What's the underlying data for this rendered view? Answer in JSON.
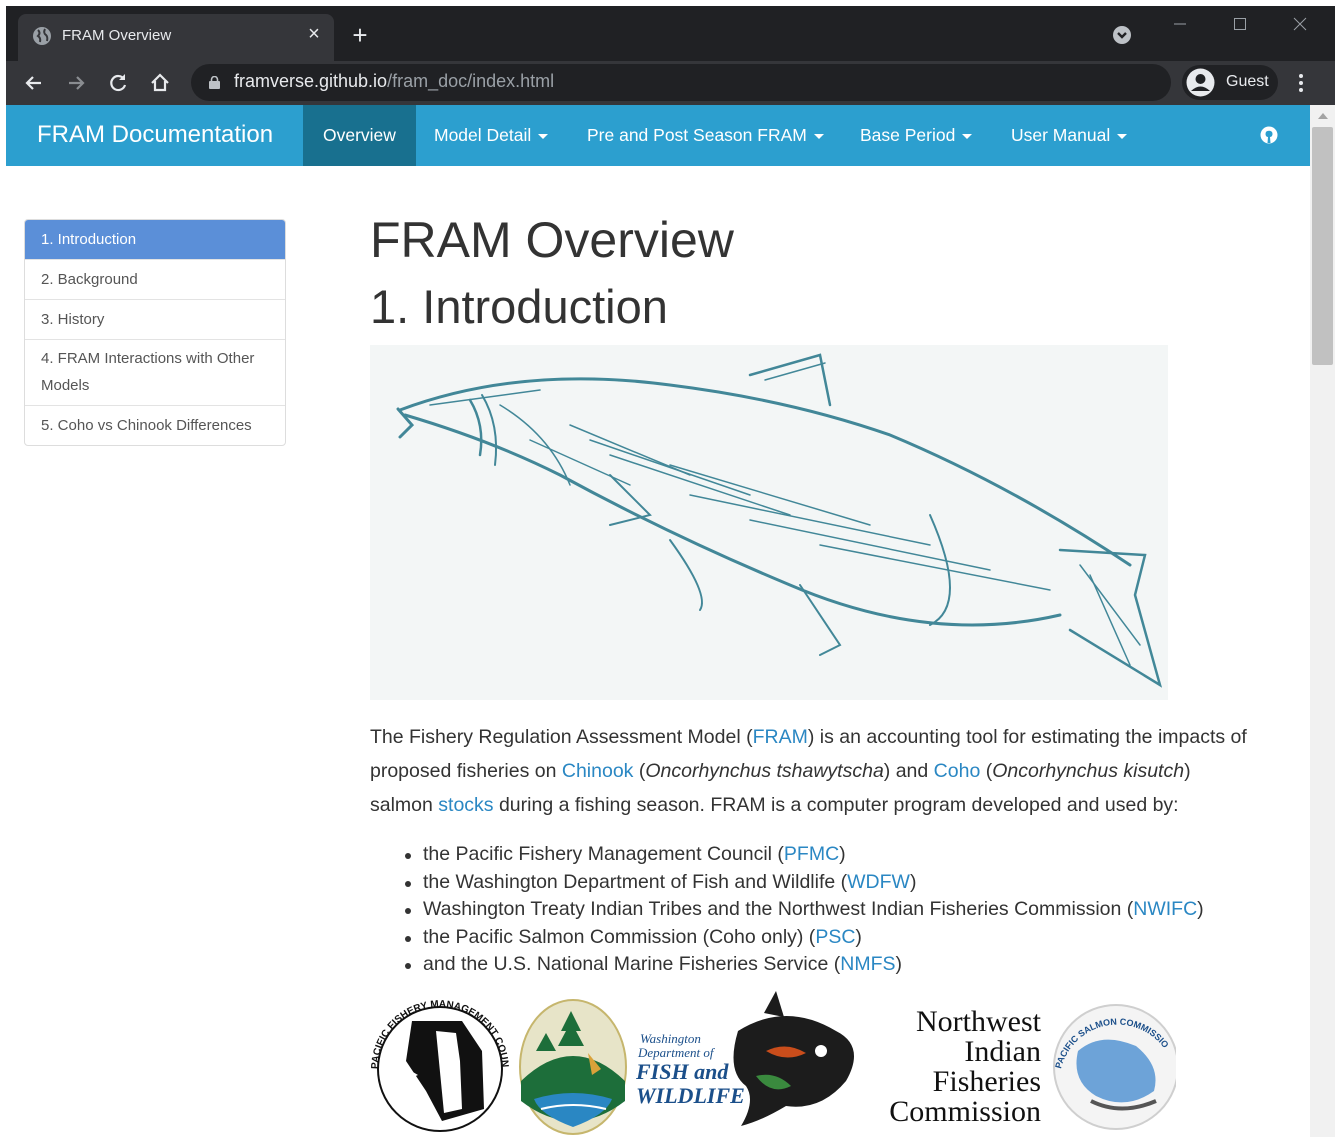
{
  "browser": {
    "tab_title": "FRAM Overview",
    "tab_close": "×",
    "new_tab": "+",
    "url_host": "framverse.github.io",
    "url_path": "/fram_doc/index.html",
    "profile_name": "Guest"
  },
  "navbar": {
    "brand": "FRAM Documentation",
    "items": [
      {
        "label": "Overview",
        "active": true,
        "dropdown": false
      },
      {
        "label": "Model Detail",
        "dropdown": true
      },
      {
        "label": "Pre and Post Season FRAM",
        "dropdown": true
      },
      {
        "label": "Base Period",
        "dropdown": true
      },
      {
        "label": "User Manual",
        "dropdown": true
      }
    ],
    "accent": "#2c9fcf",
    "active_bg": "#18708f"
  },
  "sidebar": {
    "items": [
      {
        "label": "1. Introduction",
        "active": true
      },
      {
        "label": "2. Background"
      },
      {
        "label": "3. History"
      },
      {
        "label": "4. FRAM Interactions with Other"
      },
      {
        "label": "Models"
      },
      {
        "label": "5. Coho vs Chinook Differences"
      }
    ]
  },
  "main": {
    "title": "FRAM Overview",
    "section": "1. Introduction",
    "para": {
      "t1": "The Fishery Regulation Assessment Model (",
      "fram": "FRAM",
      "t2": ") is an accounting tool for estimating the impacts of proposed fisheries on ",
      "chinook": "Chinook",
      "t3": " (",
      "chinook_sci": "Oncorhynchus tshawytscha",
      "t4": ") and ",
      "coho": "Coho",
      "t5": " (",
      "coho_sci": "Oncorhynchus kisutch",
      "t6": ") salmon ",
      "stocks": "stocks",
      "t7": " during a fishing season. FRAM is a computer program developed and used by:"
    },
    "bullets": [
      {
        "text": "the Pacific Fishery Management Council (",
        "link": "PFMC",
        "end": ")"
      },
      {
        "text": "the Washington Department of Fish and Wildlife (",
        "link": "WDFW",
        "end": ")"
      },
      {
        "text": "Washington Treaty Indian Tribes and the Northwest Indian Fisheries Commission (",
        "link": "NWIFC",
        "end": ")"
      },
      {
        "text": "the Pacific Salmon Commission (Coho only) (",
        "link": "PSC",
        "end": ")"
      },
      {
        "text": "and the U.S. National Marine Fisheries Service (",
        "link": "NMFS",
        "end": ")"
      }
    ],
    "link_color": "#2a87c3"
  },
  "logos": {
    "pfmc": "PACIFIC FISHERY MANAGEMENT COUNCIL",
    "wdfw_1": "Washington",
    "wdfw_2": "Department of",
    "wdfw_3": "FISH and",
    "wdfw_4": "WILDLIFE",
    "nwifc_1": "Northwest",
    "nwifc_2": "Indian",
    "nwifc_3": "Fisheries",
    "nwifc_4": "Commission",
    "psc": "PACIFIC SALMON COMMISSION"
  }
}
